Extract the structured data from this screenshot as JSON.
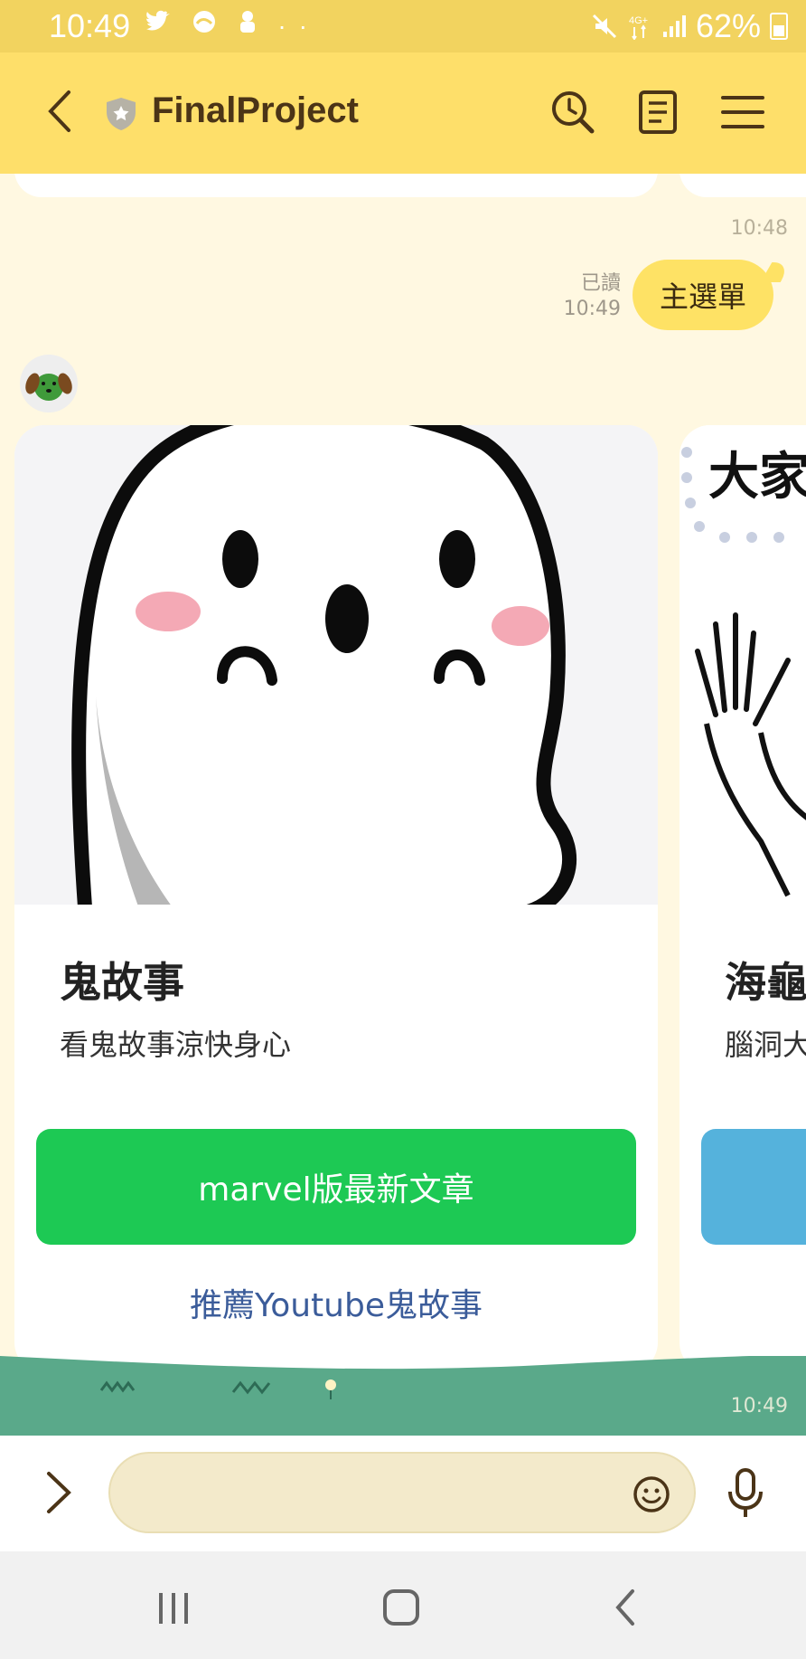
{
  "status_bar": {
    "time": "10:49",
    "battery": "62%"
  },
  "header": {
    "title": "FinalProject"
  },
  "messages": {
    "prev_timestamp": "10:48",
    "sent": {
      "text": "主選單",
      "read_label": "已讀",
      "time": "10:49"
    },
    "carousel_timestamp": "10:49"
  },
  "cards": [
    {
      "title": "鬼故事",
      "description": "看鬼故事涼快身心",
      "primary_action": "marvel版最新文章",
      "link_action": "推薦Youtube鬼故事"
    },
    {
      "title": "海龜",
      "description": "腦洞大",
      "image_text": "大家"
    }
  ],
  "colors": {
    "header_bg": "#fedf6a",
    "primary_green": "#1dc954",
    "secondary_blue": "#55b2dc",
    "bubble": "#fee265"
  }
}
